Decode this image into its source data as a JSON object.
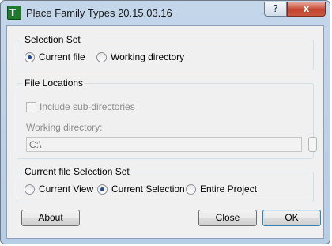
{
  "window": {
    "title": "Place Family Types 20.15.03.16",
    "icon_glyph": "T",
    "help_label": "?",
    "close_label": "x"
  },
  "selection_set": {
    "title": "Selection Set",
    "options": [
      "Current file",
      "Working directory"
    ],
    "selected": "Current file"
  },
  "file_locations": {
    "title": "File Locations",
    "include_subdirectories_label": "Include sub-directories",
    "include_subdirectories_checked": false,
    "working_directory_label": "Working directory:",
    "working_directory_value": "C:\\"
  },
  "current_file_selection_set": {
    "title": "Current file Selection Set",
    "options": [
      "Current View",
      "Current Selection",
      "Entire Project"
    ],
    "selected": "Current Selection"
  },
  "buttons": {
    "about": "About",
    "close": "Close",
    "ok": "OK"
  }
}
